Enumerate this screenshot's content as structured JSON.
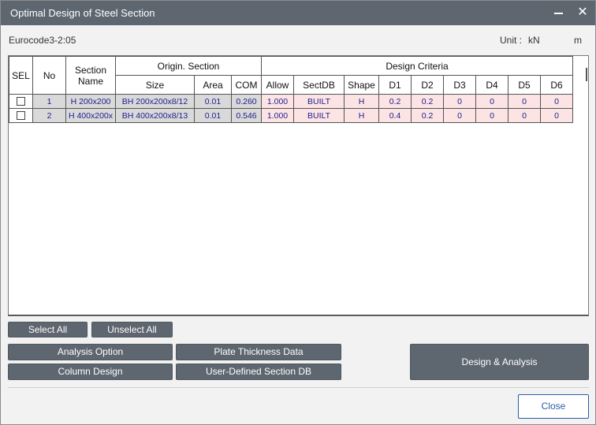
{
  "window": {
    "title": "Optimal Design of Steel Section"
  },
  "info": {
    "code": "Eurocode3-2:05",
    "unit_label": "Unit :",
    "force_unit": "kN",
    "length_unit": "m"
  },
  "table": {
    "header_top": {
      "sel": "SEL",
      "no": "No",
      "section_name": "Section Name",
      "origin_section": "Origin. Section",
      "design_criteria": "Design Criteria"
    },
    "header_sub": [
      "Size",
      "Area",
      "COM",
      "Allow",
      "SectDB",
      "Shape",
      "D1",
      "D2",
      "D3",
      "D4",
      "D5",
      "D6"
    ],
    "rows": [
      {
        "no": "1",
        "section_name": "H 200x200",
        "size": "BH 200x200x8/12",
        "area": "0.01",
        "com": "0.260",
        "allow": "1.000",
        "sectdb": "BUILT",
        "shape": "H",
        "d1": "0.2",
        "d2": "0.2",
        "d3": "0",
        "d4": "0",
        "d5": "0",
        "d6": "0"
      },
      {
        "no": "2",
        "section_name": "H 400x200x",
        "size": "BH 400x200x8/13",
        "area": "0.01",
        "com": "0.546",
        "allow": "1.000",
        "sectdb": "BUILT",
        "shape": "H",
        "d1": "0.4",
        "d2": "0.2",
        "d3": "0",
        "d4": "0",
        "d5": "0",
        "d6": "0"
      }
    ]
  },
  "buttons": {
    "select_all": "Select All",
    "unselect_all": "Unselect All",
    "analysis_option": "Analysis Option",
    "plate_thickness": "Plate Thickness Data",
    "column_design": "Column Design",
    "user_defined_db": "User-Defined Section DB",
    "design_analysis": "Design & Analysis",
    "close": "Close"
  },
  "colors": {
    "titlebar": "#5e6670",
    "button": "#5e6670",
    "pink_cell": "#fde4e4",
    "gray_cell": "#d9d9d9",
    "close_accent": "#2a5da8"
  }
}
